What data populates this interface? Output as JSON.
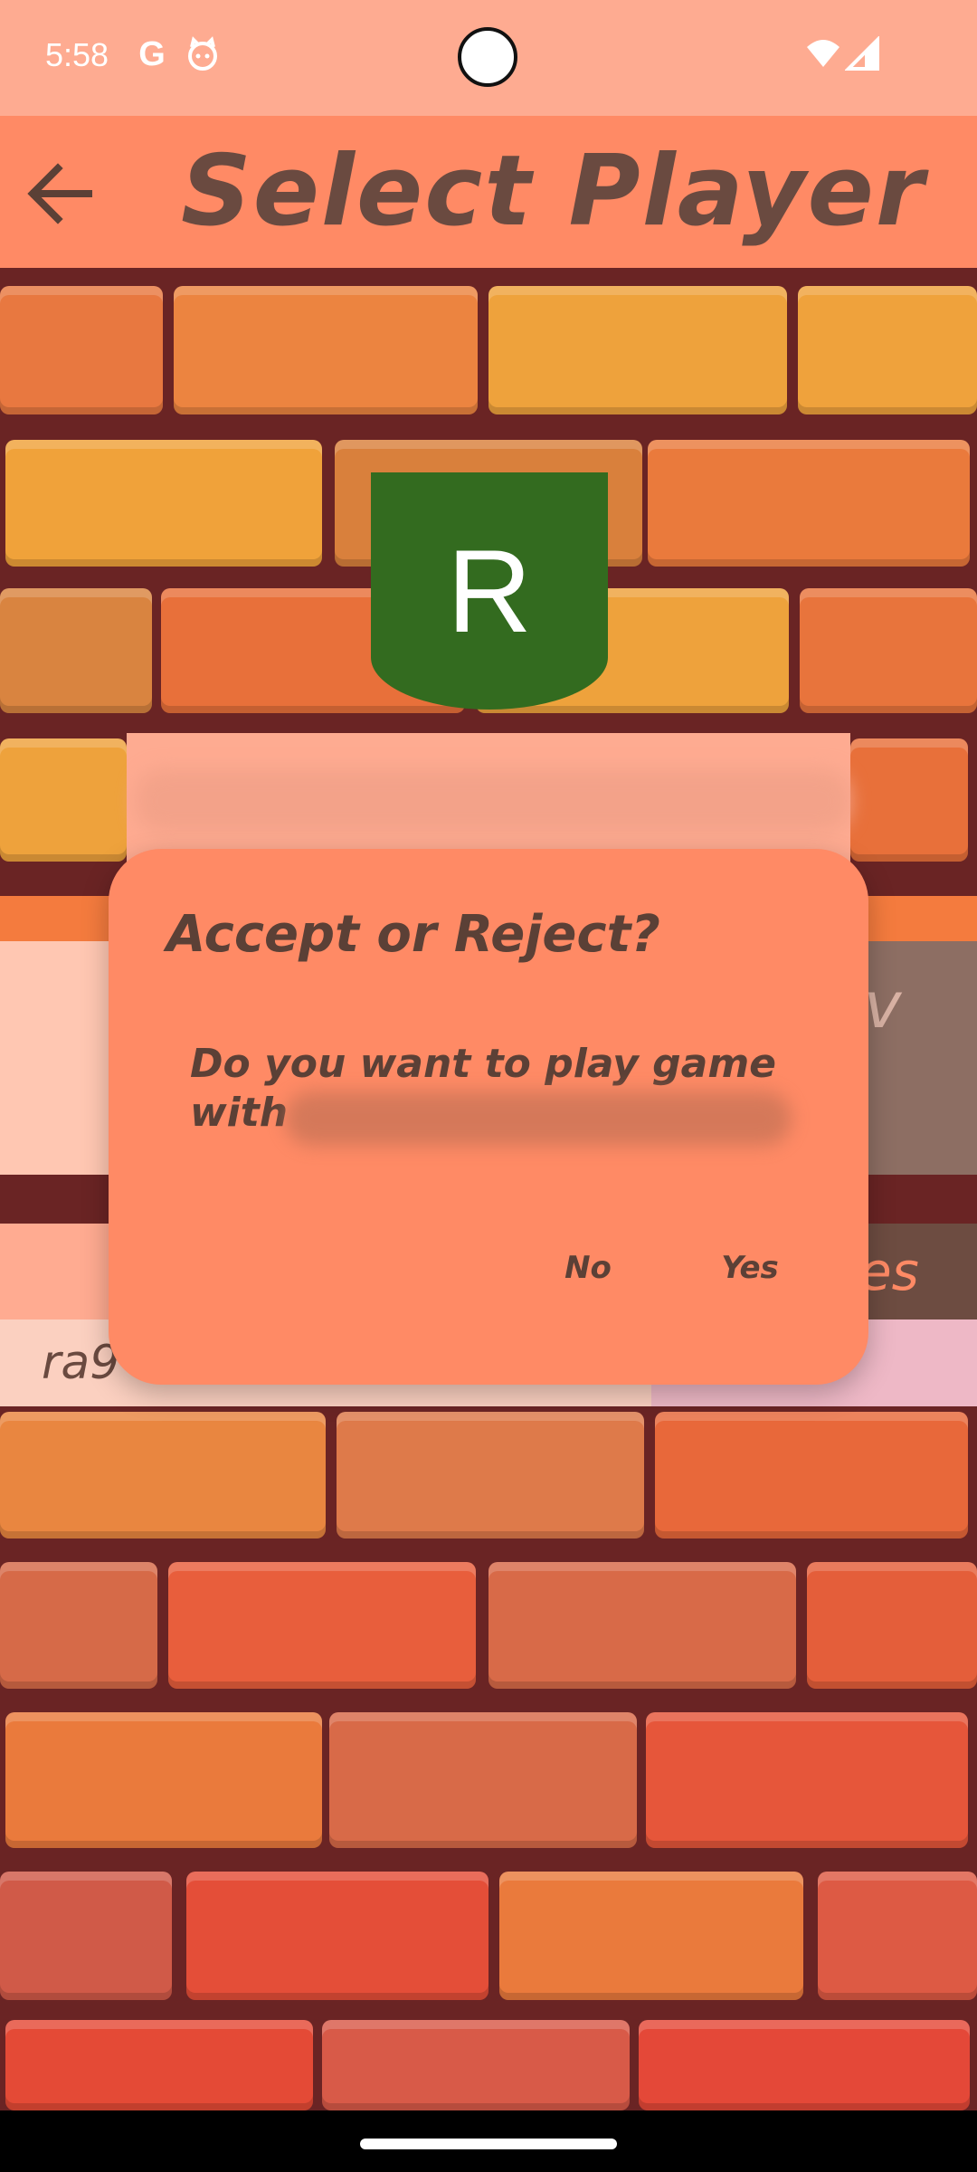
{
  "status_bar": {
    "time": "5:58",
    "left_icons": [
      "google-g-icon",
      "cat-face-icon"
    ],
    "right_icons": [
      "wifi-icon",
      "signal-icon"
    ]
  },
  "app_bar": {
    "title": "Select Player",
    "back_icon": "arrow-left-icon"
  },
  "player": {
    "avatar_letter": "R",
    "avatar_color": "#336b1f",
    "partial_name_behind_dialog": "ra9",
    "partial_right_text": "v",
    "partial_stats_text": "es"
  },
  "dialog": {
    "title": "Accept or Reject?",
    "message_line1": "Do you want to play game",
    "message_line2": "with",
    "no_label": "No",
    "yes_label": "Yes"
  },
  "colors": {
    "status_bar": "#feab91",
    "app_bar": "#ff8a65",
    "dialog": "#ff8a65",
    "text_brown": "#5b4036"
  }
}
